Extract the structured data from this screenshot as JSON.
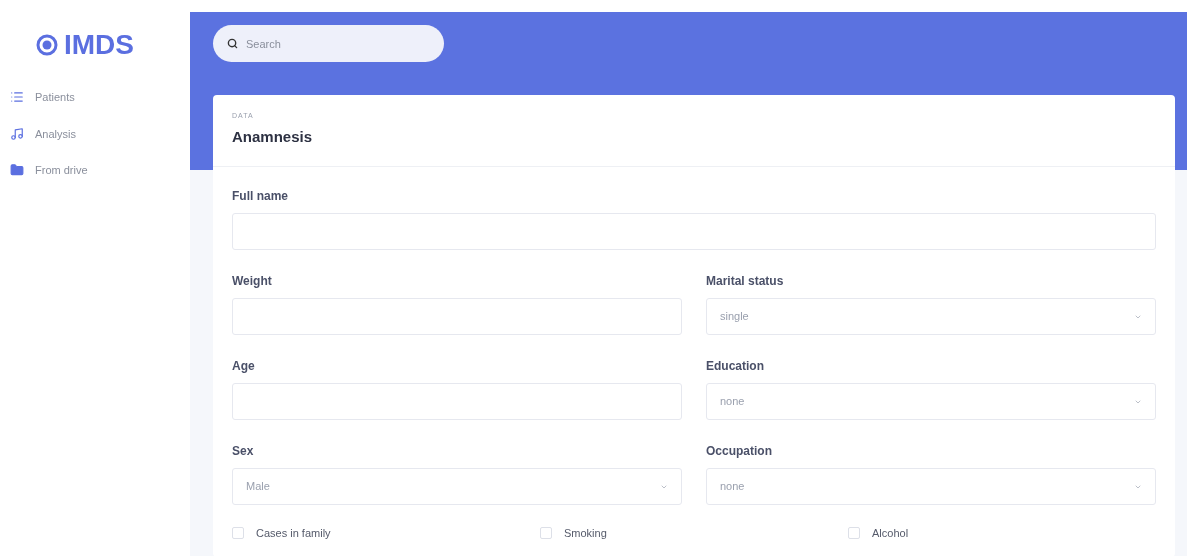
{
  "sidebar": {
    "logo": "IMDS",
    "items": [
      {
        "label": "Patients"
      },
      {
        "label": "Analysis"
      },
      {
        "label": "From drive"
      }
    ]
  },
  "search": {
    "placeholder": "Search"
  },
  "card": {
    "overline": "DATA",
    "title": "Anamnesis",
    "rows": [
      [
        {
          "label": "Full name",
          "kind": "text"
        }
      ],
      [
        {
          "label": "Weight",
          "kind": "text"
        },
        {
          "label": "Marital status",
          "kind": "select",
          "value": "single"
        }
      ],
      [
        {
          "label": "Age",
          "kind": "text"
        },
        {
          "label": "Education",
          "kind": "select",
          "value": "none"
        }
      ],
      [
        {
          "label": "Sex",
          "kind": "select",
          "value": "Male"
        },
        {
          "label": "Occupation",
          "kind": "select",
          "value": "none"
        }
      ]
    ],
    "checkboxes": [
      {
        "label": "Cases in family",
        "checked": false
      },
      {
        "label": "Smoking",
        "checked": false
      },
      {
        "label": "Alcohol",
        "checked": false
      }
    ]
  }
}
